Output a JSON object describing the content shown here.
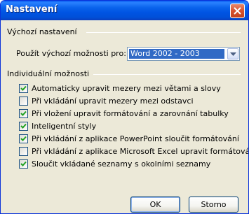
{
  "window": {
    "title": "Nastavení",
    "close_icon": "close-x-icon"
  },
  "defaults_group": {
    "label": "Výchozí nastavení",
    "use_label": "Použít výchozí možnosti pro:",
    "select_value": "Word 2002 - 2003"
  },
  "individual_group": {
    "label": "Individuální možnosti",
    "options": [
      {
        "label": "Automaticky upravit mezery mezi větami a slovy",
        "checked": true
      },
      {
        "label": "Při vkládání upravit mezery mezi odstavci",
        "checked": false
      },
      {
        "label": "Při vložení upravit formátování a zarovnání tabulky",
        "checked": true
      },
      {
        "label": "Inteligentní styly",
        "checked": true
      },
      {
        "label": "Při vkládání z aplikace PowerPoint sloučit formátování",
        "checked": true
      },
      {
        "label": "Při vkládání z aplikace Microsoft Excel upravit formátování",
        "checked": false
      },
      {
        "label": "Sloučit vkládané seznamy s okolními seznamy",
        "checked": true
      }
    ]
  },
  "buttons": {
    "ok": "OK",
    "cancel": "Storno"
  },
  "colors": {
    "titlebar": "#0054e3",
    "selection": "#316ac5",
    "dialog_bg": "#ece9d8",
    "close_button": "#d8512e"
  }
}
